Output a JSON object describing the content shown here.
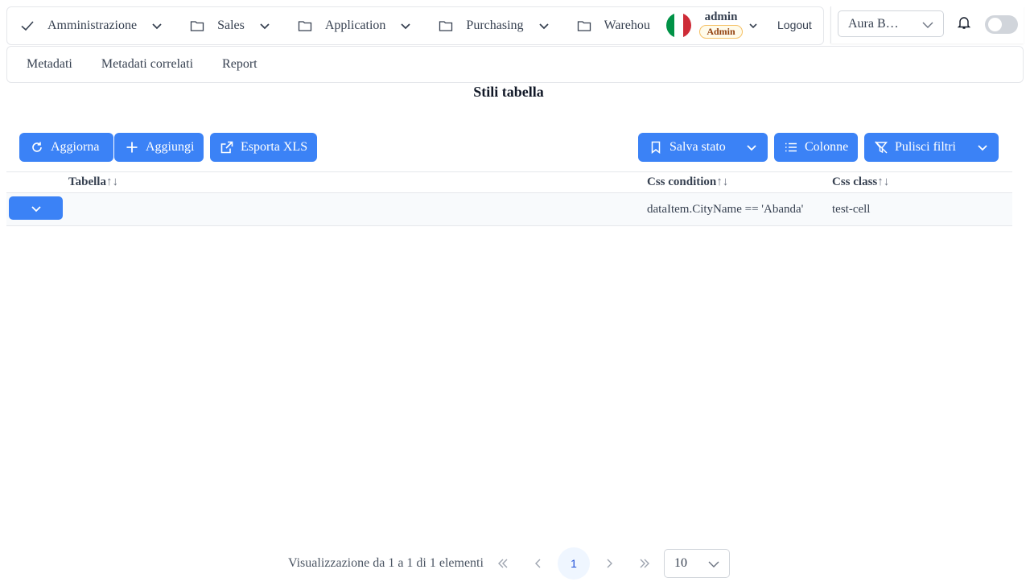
{
  "menubar": {
    "items": [
      {
        "label": "Amministrazione",
        "icon": "check-icon"
      },
      {
        "label": "Sales",
        "icon": "folder-icon"
      },
      {
        "label": "Application",
        "icon": "folder-icon"
      },
      {
        "label": "Purchasing",
        "icon": "folder-icon"
      },
      {
        "label": "Warehou",
        "icon": "folder-icon"
      }
    ],
    "user": {
      "name": "admin",
      "role": "Admin"
    },
    "logout_label": "Logout",
    "flag_colors": [
      "#009246",
      "#ffffff",
      "#ce2b37"
    ]
  },
  "topright": {
    "company_select_value": "Aura B…",
    "notification_icon": "bell-icon",
    "theme_toggle_on": false
  },
  "submenu": {
    "items": [
      "Metadati",
      "Metadati correlati",
      "Report"
    ]
  },
  "page": {
    "title": "Stili tabella"
  },
  "toolbar": {
    "refresh_label": "Aggiorna",
    "add_label": "Aggiungi",
    "export_label": "Esporta XLS",
    "save_state_label": "Salva stato",
    "columns_label": "Colonne",
    "clear_filters_label": "Pulisci filtri"
  },
  "table": {
    "columns": [
      "Tabella",
      "Css condition",
      "Css class"
    ],
    "sort_glyph": "↑↓",
    "rows": [
      {
        "tabella": "",
        "css_condition": "dataItem.CityName == 'Abanda'",
        "css_class": "test-cell"
      }
    ]
  },
  "paginator": {
    "summary": "Visualizzazione da 1 a 1 di 1 elementi",
    "current_page": "1",
    "rows_per_page": "10"
  },
  "colors": {
    "primary": "#3b82f6",
    "border": "#e5e7eb",
    "text": "#374151"
  }
}
